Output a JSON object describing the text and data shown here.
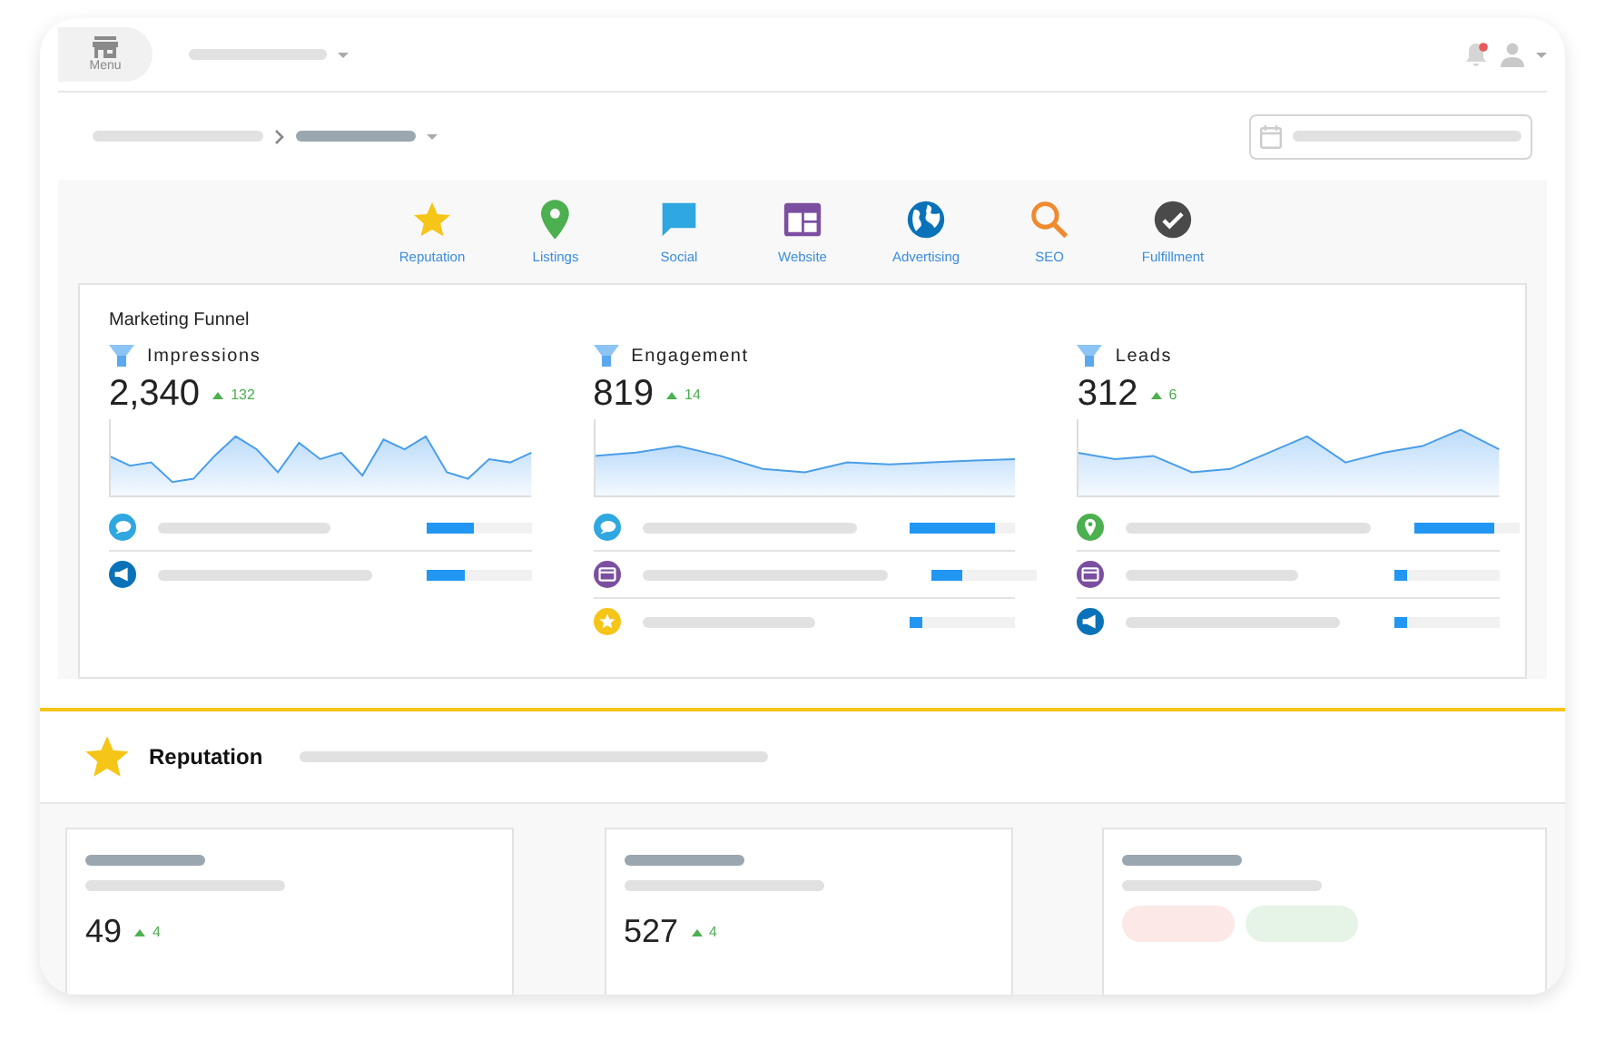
{
  "top_bar": {
    "menu_label": "Menu",
    "notification": true
  },
  "nav": [
    {
      "kind": "star",
      "label": "Reputation"
    },
    {
      "kind": "pin",
      "label": "Listings"
    },
    {
      "kind": "chat",
      "label": "Social"
    },
    {
      "kind": "website",
      "label": "Website"
    },
    {
      "kind": "globe",
      "label": "Advertising"
    },
    {
      "kind": "search",
      "label": "SEO"
    },
    {
      "kind": "check",
      "label": "Fulfillment"
    }
  ],
  "funnel": {
    "title": "Marketing Funnel",
    "columns": [
      {
        "title": "Impressions",
        "value": "2,340",
        "delta": "132",
        "rows": [
          {
            "kind": "chat",
            "level": 0.45
          },
          {
            "kind": "megaphone",
            "level": 0.37
          }
        ]
      },
      {
        "title": "Engagement",
        "value": "819",
        "delta": "14",
        "rows": [
          {
            "kind": "chat",
            "level": 0.8
          },
          {
            "kind": "website",
            "level": 0.3
          },
          {
            "kind": "star",
            "level": 0.12
          }
        ]
      },
      {
        "title": "Leads",
        "value": "312",
        "delta": "6",
        "rows": [
          {
            "kind": "pin",
            "level": 0.75
          },
          {
            "kind": "website",
            "level": 0.12
          },
          {
            "kind": "megaphone",
            "level": 0.12
          }
        ]
      }
    ]
  },
  "reputation": {
    "title": "Reputation",
    "cards": [
      {
        "kind": "metric",
        "value": "49",
        "delta": "4"
      },
      {
        "kind": "metric",
        "value": "527",
        "delta": "4"
      },
      {
        "kind": "pills"
      }
    ]
  }
}
